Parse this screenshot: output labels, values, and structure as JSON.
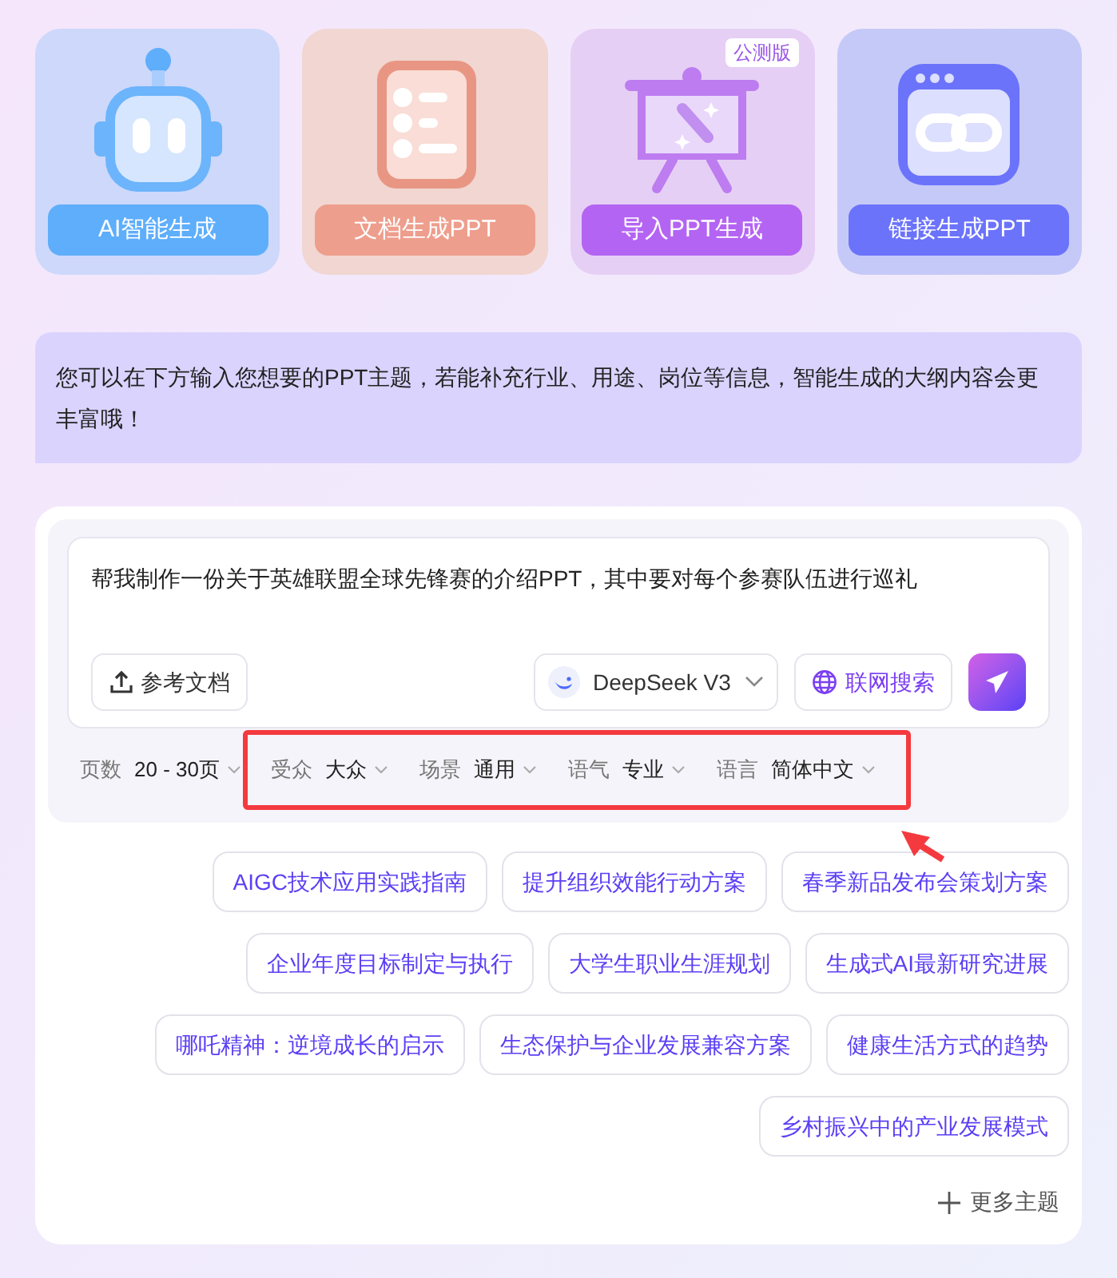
{
  "modes": [
    {
      "kind": "robot",
      "label": "AI智能生成"
    },
    {
      "kind": "document",
      "label": "文档生成PPT"
    },
    {
      "kind": "easel",
      "label": "导入PPT生成",
      "badge": "公测版"
    },
    {
      "kind": "link",
      "label": "链接生成PPT"
    }
  ],
  "hint": "您可以在下方输入您想要的PPT主题，若能补充行业、用途、岗位等信息，智能生成的大纲内容会更丰富哦！",
  "composer": {
    "value": "帮我制作一份关于英雄联盟全球先锋赛的介绍PPT，其中要对每个参赛队伍进行巡礼",
    "upload_label": "参考文档",
    "model": "DeepSeek V3",
    "web_search": "联网搜索"
  },
  "options": [
    {
      "label": "页数",
      "value": "20 - 30页"
    },
    {
      "label": "受众",
      "value": "大众"
    },
    {
      "label": "场景",
      "value": "通用"
    },
    {
      "label": "语气",
      "value": "专业"
    },
    {
      "label": "语言",
      "value": "简体中文"
    }
  ],
  "topic_rows": [
    [
      "AIGC技术应用实践指南",
      "提升组织效能行动方案",
      "春季新品发布会策划方案"
    ],
    [
      "企业年度目标制定与执行",
      "大学生职业生涯规划",
      "生成式AI最新研究进展"
    ],
    [
      "哪吒精神：逆境成长的启示",
      "生态保护与企业发展兼容方案",
      "健康生活方式的趋势"
    ],
    [
      "乡村振兴中的产业发展模式"
    ]
  ],
  "more_topics": "更多主题"
}
